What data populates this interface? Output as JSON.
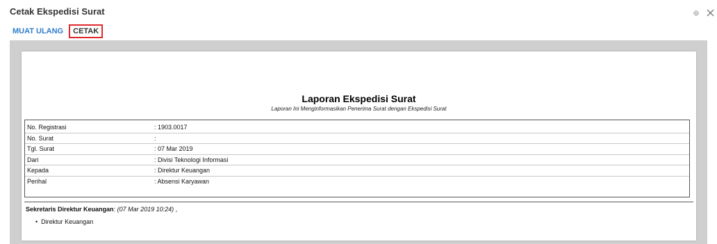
{
  "window": {
    "title": "Cetak Ekspedisi Surat",
    "expand_icon": "expand-icon",
    "close_icon": "close-icon"
  },
  "toolbar": {
    "reload_label": "MUAT ULANG",
    "print_label": "CETAK"
  },
  "report": {
    "title": "Laporan Ekspedisi Surat",
    "subtitle": "Laporan Ini Menginformasikan Penerima Surat dengan Ekspedisi Surat",
    "fields": [
      {
        "label": "No. Registrasi",
        "value": ":  1903.0017"
      },
      {
        "label": "No. Surat",
        "value": ":"
      },
      {
        "label": "Tgl. Surat",
        "value": ":  07 Mar 2019"
      },
      {
        "label": "Dari",
        "value": ":  Divisi Teknologi Informasi"
      },
      {
        "label": "Kepada",
        "value": ":  Direktur Keuangan"
      },
      {
        "label": "Perihal",
        "value": ":  Absensi Karyawan"
      }
    ],
    "note": {
      "author": "Sekretaris Direktur Keuangan",
      "sep": ": ",
      "timestamp": "(07 Mar 2019 10:24)",
      "suffix": " ,"
    },
    "recipients": [
      "Direktur Keuangan"
    ]
  }
}
